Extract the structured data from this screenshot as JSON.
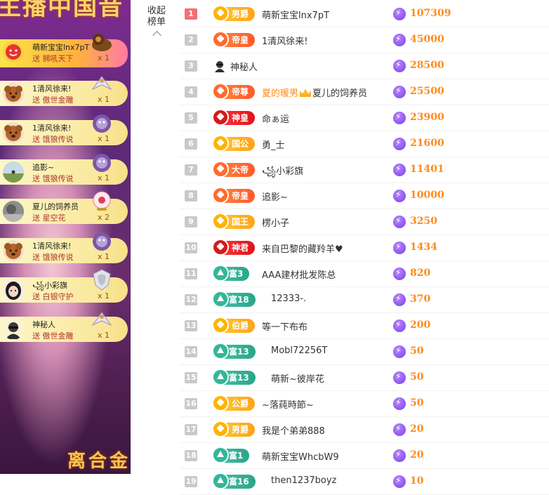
{
  "stream": {
    "top_title": "主播中国音",
    "bottom_title": "离合金",
    "gifts": [
      {
        "user": "萌新宝宝lnx7pT",
        "gift": "送 狮吼天下",
        "count": "x 1",
        "avatar": "red-face-avatar",
        "gift_icon": "lion-gift-icon"
      },
      {
        "user": "1清风徐来!",
        "gift": "送 傲世金雕",
        "count": "x 1",
        "avatar": "teddy-dog-avatar",
        "gift_icon": "eagle-gift-icon"
      },
      {
        "user": "1清风徐来!",
        "gift": "送 饿狼传说",
        "count": "x 1",
        "avatar": "teddy-dog-avatar",
        "gift_icon": "wolf-gift-icon"
      },
      {
        "user": "追影~",
        "gift": "送 饿狼传说",
        "count": "x 1",
        "avatar": "landscape-avatar",
        "gift_icon": "wolf-gift-icon"
      },
      {
        "user": "夏儿的饲养员",
        "gift": "送 星空花",
        "count": "x 2",
        "avatar": "grey-photo-avatar",
        "gift_icon": "star-flower-gift-icon"
      },
      {
        "user": "1清风徐来!",
        "gift": "送 饿狼传说",
        "count": "x 1",
        "avatar": "teddy-dog-avatar",
        "gift_icon": "wolf-gift-icon"
      },
      {
        "user": "꧁小彩旗",
        "gift": "送 白银守护",
        "count": "x 1",
        "avatar": "girl-avatar",
        "gift_icon": "silver-guard-gift-icon"
      },
      {
        "user": "神秘人",
        "gift": "送 傲世金雕",
        "count": "x 1",
        "avatar": "mystery-avatar",
        "gift_icon": "eagle-gift-icon"
      }
    ]
  },
  "collapse": {
    "label1": "收起",
    "label2": "榜单",
    "icon": "chevron-up-icon"
  },
  "colors": {
    "value": "#ff8a1a",
    "rank1": "#f37072",
    "rank_default": "#c9c9c9"
  },
  "ranking": [
    {
      "rank": "1",
      "badge": "男爵",
      "badge_type": "noble",
      "name": "萌新宝宝lnx7pT",
      "value": "107309"
    },
    {
      "rank": "2",
      "badge": "帝皇",
      "badge_type": "emperor",
      "name": "1清风徐来!",
      "value": "45000"
    },
    {
      "rank": "3",
      "badge": "",
      "badge_type": "none",
      "name": "神秘人",
      "value": "28500"
    },
    {
      "rank": "4",
      "badge": "帝尊",
      "badge_type": "emperor",
      "name_pre": "夏的暖男",
      "name": "夏儿的饲养员",
      "value": "25500"
    },
    {
      "rank": "5",
      "badge": "神皇",
      "badge_type": "god",
      "name": "命ぁ运",
      "value": "23900"
    },
    {
      "rank": "6",
      "badge": "国公",
      "badge_type": "noble",
      "name": "勇_士",
      "value": "21600"
    },
    {
      "rank": "7",
      "badge": "大帝",
      "badge_type": "emperor",
      "name": "꧁小彩旗",
      "value": "11401"
    },
    {
      "rank": "8",
      "badge": "帝皇",
      "badge_type": "emperor",
      "name": "追影~",
      "value": "10000"
    },
    {
      "rank": "9",
      "badge": "国王",
      "badge_type": "noble",
      "name": "楞小子",
      "value": "3250"
    },
    {
      "rank": "10",
      "badge": "神君",
      "badge_type": "god",
      "name": "来自巴黎的藏羚羊♥",
      "value": "1434"
    },
    {
      "rank": "11",
      "badge": "富3",
      "badge_type": "rich",
      "name": "AAA建材批发陈总",
      "value": "820"
    },
    {
      "rank": "12",
      "badge": "富18",
      "badge_type": "rich",
      "name": "12333-.",
      "value": "370"
    },
    {
      "rank": "13",
      "badge": "伯爵",
      "badge_type": "noble",
      "name": "等一下布布",
      "value": "200"
    },
    {
      "rank": "14",
      "badge": "富13",
      "badge_type": "rich",
      "name": "Mobl72256T",
      "value": "50"
    },
    {
      "rank": "15",
      "badge": "富13",
      "badge_type": "rich",
      "name": "萌新~彼岸花",
      "value": "50"
    },
    {
      "rank": "16",
      "badge": "公爵",
      "badge_type": "noble",
      "name": "~落莼時節~",
      "value": "50"
    },
    {
      "rank": "17",
      "badge": "男爵",
      "badge_type": "noble",
      "name": "我是个弟弟888",
      "value": "20"
    },
    {
      "rank": "18",
      "badge": "富1",
      "badge_type": "rich",
      "name": "萌新宝宝WhcbW9",
      "value": "20"
    },
    {
      "rank": "19",
      "badge": "富16",
      "badge_type": "rich",
      "name": "then1237boyz",
      "value": "10"
    }
  ]
}
